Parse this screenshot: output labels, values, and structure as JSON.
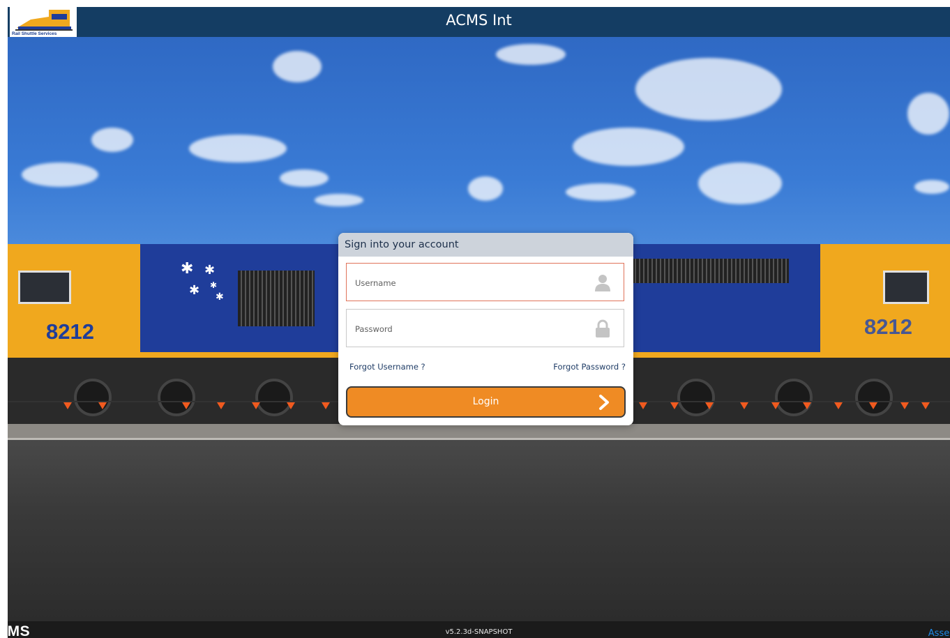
{
  "header": {
    "title": "ACMS Int",
    "logo_text": "Rail Shuttle Services"
  },
  "background": {
    "locomotive_number": "8212"
  },
  "login": {
    "heading": "Sign into your account",
    "username_placeholder": "Username",
    "password_placeholder": "Password",
    "username_icon": "user-icon",
    "password_icon": "lock-icon",
    "forgot_username": "Forgot Username ?",
    "forgot_password": "Forgot Password ?",
    "login_label": "Login",
    "login_icon": "chevron-right-icon",
    "accent_color": "#ef8b24",
    "active_field_border": "#e0735a"
  },
  "footer": {
    "brand": "CMS",
    "version": "v5.2.3d-SNAPSHOT",
    "link": "Asses"
  },
  "colors": {
    "header_bg": "#143d63",
    "panel_header_bg": "#cdd3db",
    "footer_bg": "#1b1b1b"
  }
}
